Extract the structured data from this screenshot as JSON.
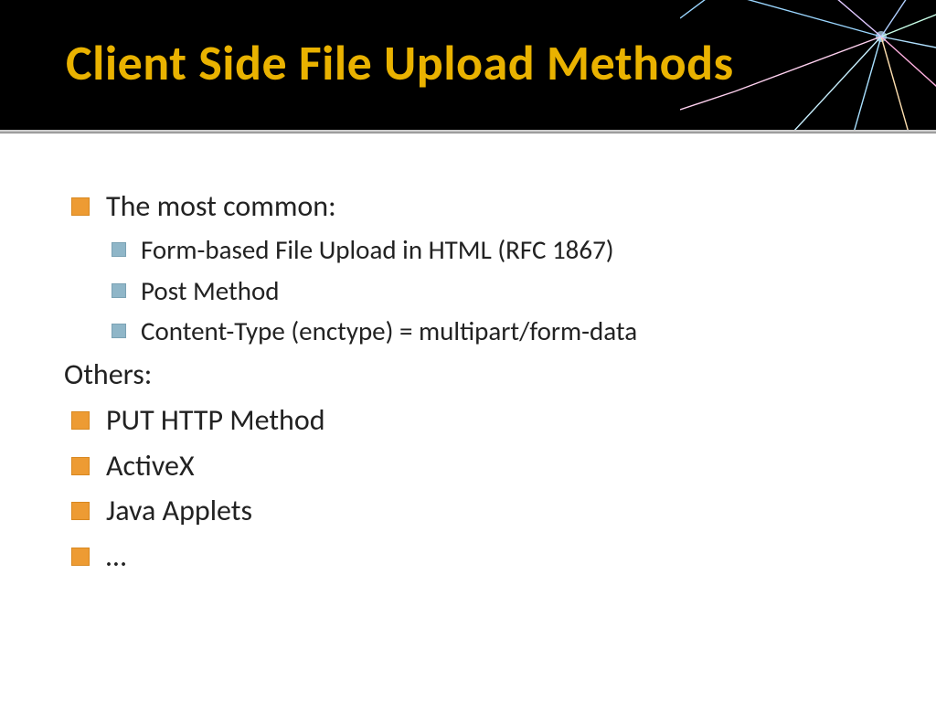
{
  "title": "Client Side File Upload Methods",
  "bullets": {
    "common_label": "The most common:",
    "common_sub": [
      "Form-based File Upload in HTML (RFC 1867)",
      "Post Method",
      "Content-Type (enctype) = multipart/form-data"
    ],
    "others_label": "Others:",
    "others": [
      "PUT HTTP Method",
      "ActiveX",
      "Java Applets",
      "…"
    ]
  },
  "colors": {
    "title": "#e9b200",
    "bullet_primary": "#ed9b33",
    "bullet_secondary": "#8fb6c8"
  }
}
